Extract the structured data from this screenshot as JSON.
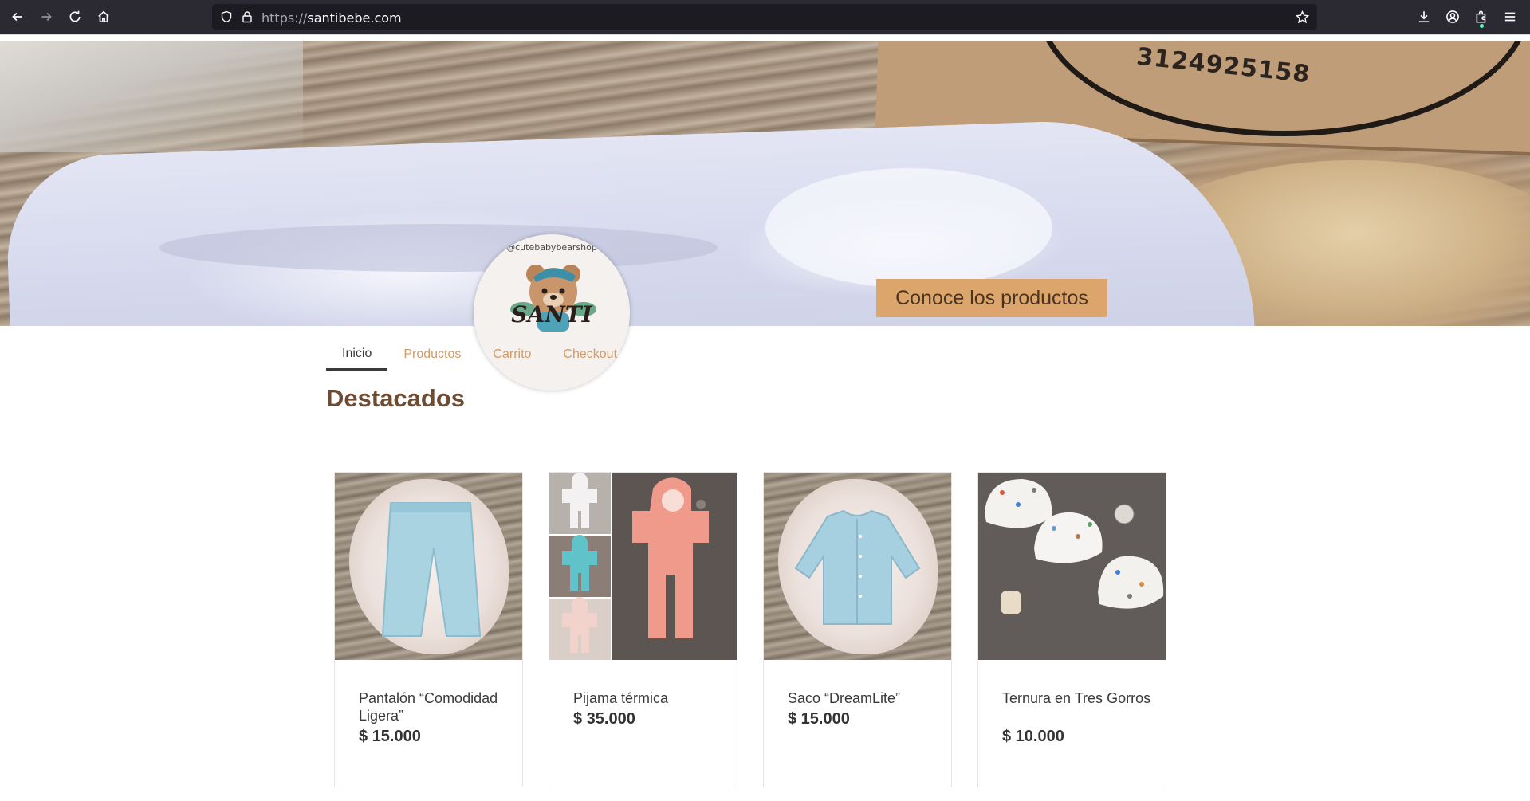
{
  "browser": {
    "url_scheme": "https://",
    "url_host": "santibebe.com",
    "icons": [
      "back-arrow-icon",
      "forward-arrow-icon",
      "reload-icon",
      "home-icon",
      "shield-icon",
      "lock-icon",
      "bookmark-star-icon",
      "download-icon",
      "account-icon",
      "extensions-icon",
      "menu-icon"
    ]
  },
  "hero": {
    "box_phone": "3124925158",
    "logo_handle": "@cutebabybearshop",
    "logo_name": "SANTI",
    "cta_label": "Conoce los productos"
  },
  "nav": {
    "tabs": [
      {
        "label": "Inicio",
        "active": true
      },
      {
        "label": "Productos",
        "active": false
      },
      {
        "label": "Carrito",
        "active": false
      },
      {
        "label": "Checkout",
        "active": false
      }
    ]
  },
  "featured": {
    "title": "Destacados",
    "products": [
      {
        "name": "Pantalón “Comodidad Ligera”",
        "price": "$ 15.000"
      },
      {
        "name": "Pijama térmica",
        "price": "$ 35.000"
      },
      {
        "name": "Saco “DreamLite”",
        "price": "$ 15.000"
      },
      {
        "name": "Ternura en Tres Gorros",
        "price": "$ 10.000"
      }
    ]
  },
  "colors": {
    "accent": "#dba56c",
    "tab_inactive": "#d29a63",
    "title_brown": "#6e4b33",
    "chrome_bg": "#2b2a33"
  }
}
